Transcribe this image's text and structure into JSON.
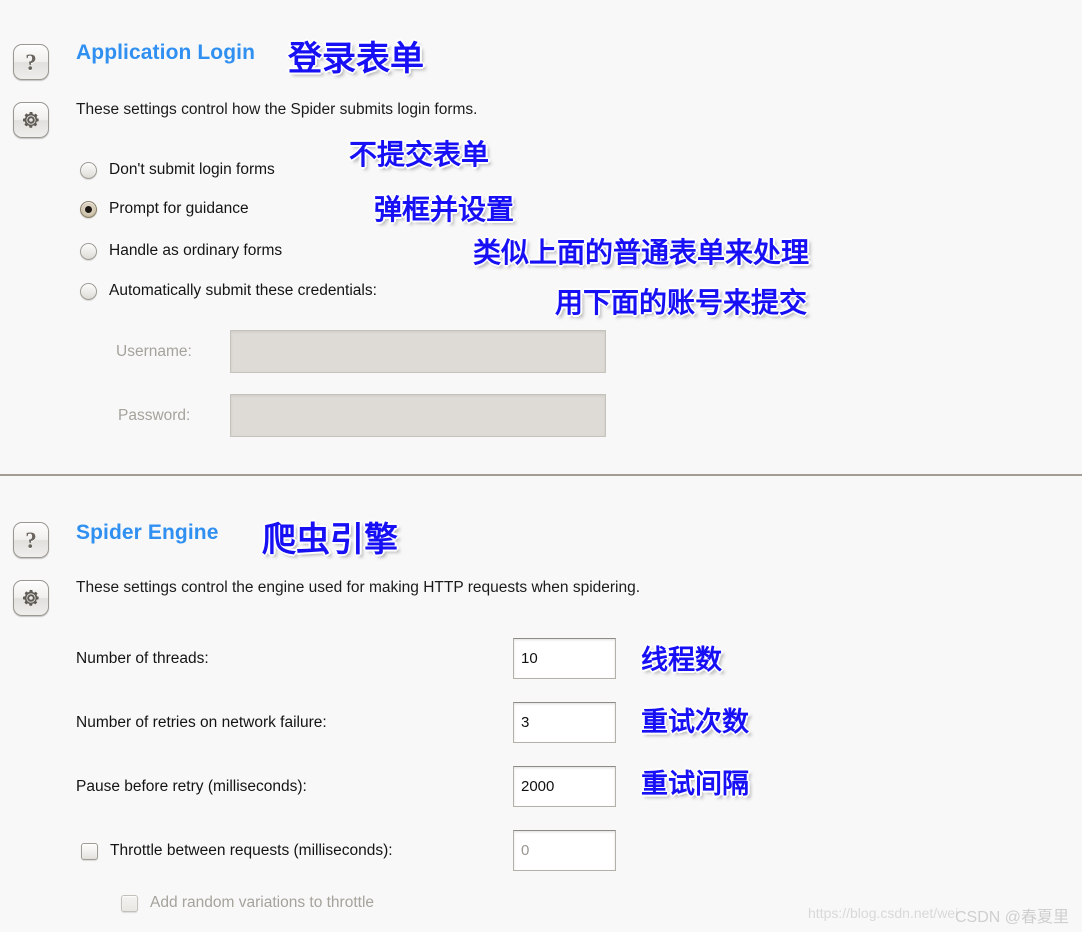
{
  "sections": [
    {
      "id": "application-login",
      "title": "Application Login",
      "title_annotation": "登录表单",
      "description": "These settings control how the Spider submits login forms.",
      "help_icon": "question-mark-icon",
      "options_icon": "gear-icon",
      "radios": [
        {
          "label": "Don't submit login forms",
          "checked": false,
          "annotation": "不提交表单"
        },
        {
          "label": "Prompt for guidance",
          "checked": true,
          "annotation": "弹框并设置"
        },
        {
          "label": "Handle as ordinary forms",
          "checked": false,
          "annotation": "类似上面的普通表单来处理"
        },
        {
          "label": "Automatically submit these credentials:",
          "checked": false,
          "annotation": "用下面的账号来提交"
        }
      ],
      "credentials": [
        {
          "label": "Username:",
          "value": "",
          "disabled": true
        },
        {
          "label": "Password:",
          "value": "",
          "disabled": true
        }
      ]
    },
    {
      "id": "spider-engine",
      "title": "Spider Engine",
      "title_annotation": "爬虫引擎",
      "description": "These settings control the engine used for making HTTP requests when spidering.",
      "help_icon": "question-mark-icon",
      "options_icon": "gear-icon",
      "fields": [
        {
          "label": "Number of threads:",
          "value": "10",
          "annotation": "线程数",
          "disabled": false
        },
        {
          "label": "Number of retries on network failure:",
          "value": "3",
          "annotation": "重试次数",
          "disabled": false
        },
        {
          "label": "Pause before retry (milliseconds):",
          "value": "2000",
          "annotation": "重试间隔",
          "disabled": false
        }
      ],
      "checkboxes": [
        {
          "label": "Throttle between requests (milliseconds):",
          "checked": false,
          "disabled": false,
          "value": "0",
          "value_disabled": true
        },
        {
          "label": "Add random variations to throttle",
          "checked": false,
          "disabled": true
        }
      ]
    }
  ],
  "watermark": {
    "url": "https://blog.csdn.net/wei",
    "brand": "CSDN @春夏里"
  },
  "colors": {
    "heading": "#2f90f2",
    "annotation": "#1810f5",
    "background": "#f8f8f8",
    "divider": "#a49d95"
  }
}
